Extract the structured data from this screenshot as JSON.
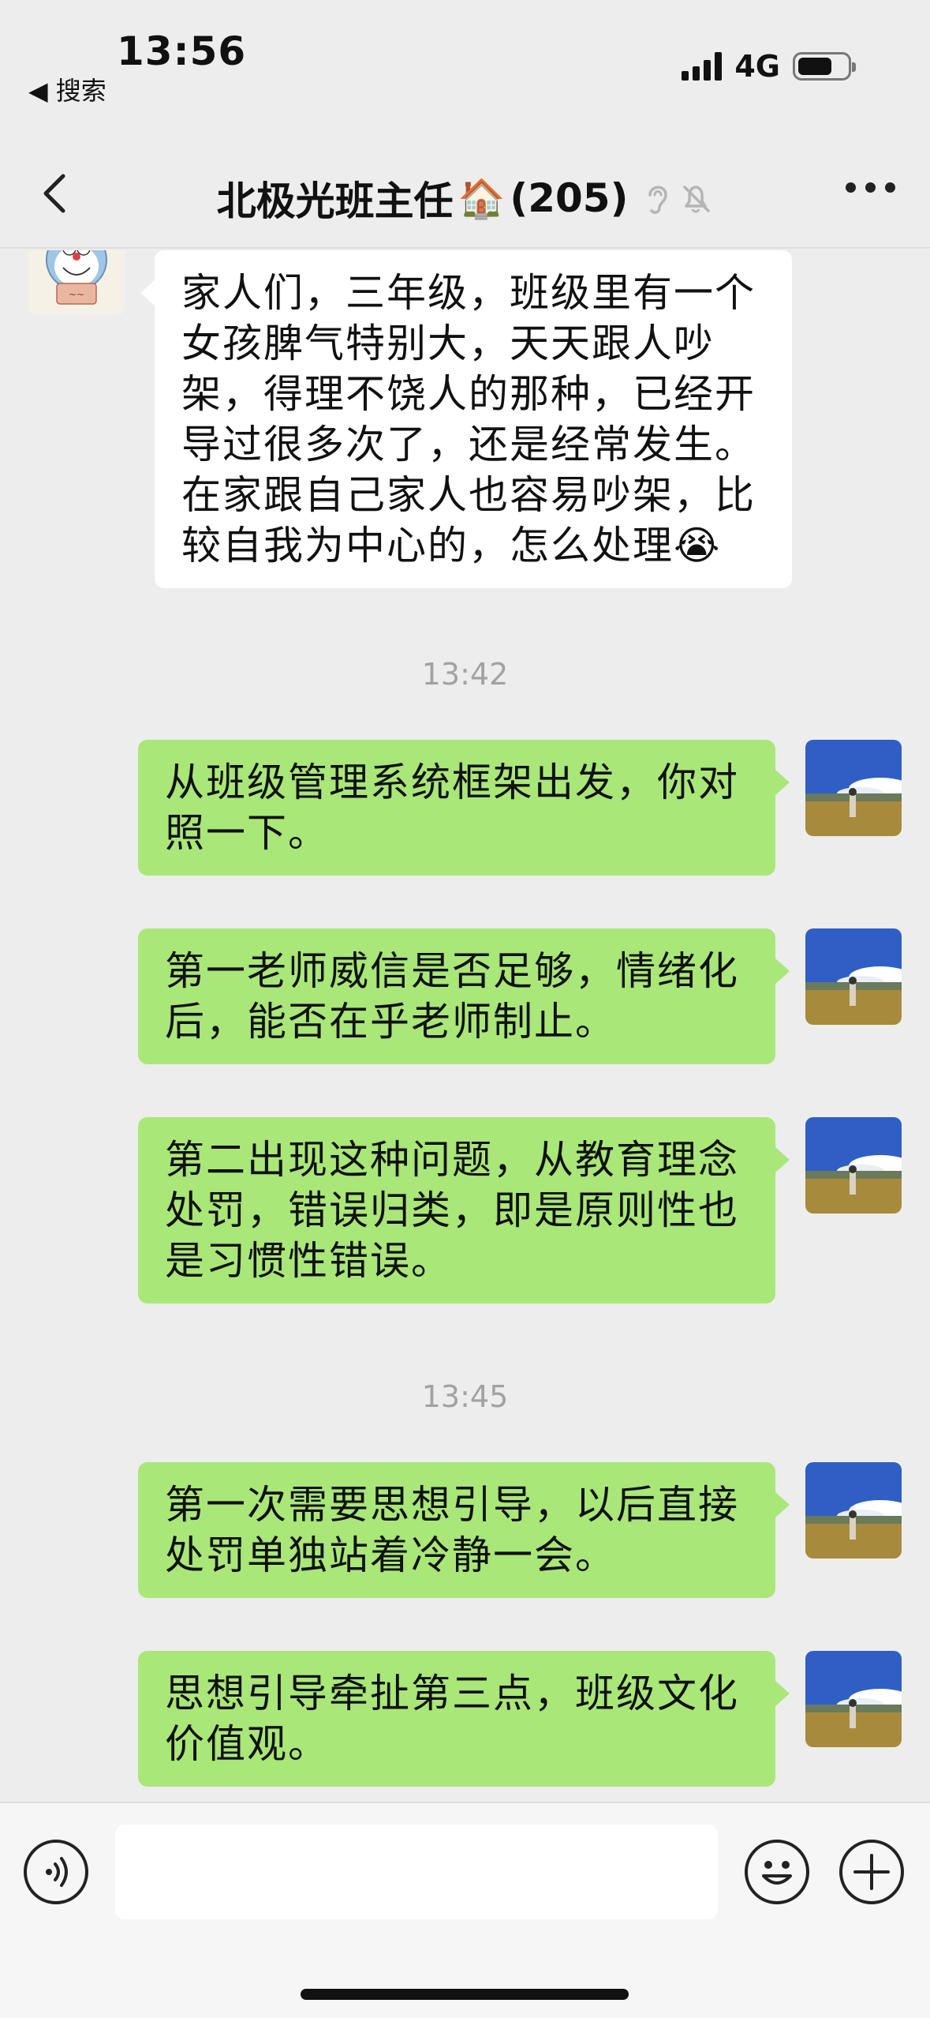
{
  "status_bar": {
    "time": "13:56",
    "back_label": "◀ 搜索",
    "network": "4G",
    "battery_level": 0.7
  },
  "nav": {
    "title": "北极光班主任",
    "title_emoji": "🏠",
    "member_count": "(205)",
    "icons": [
      "chevron-left-icon",
      "ear-icon",
      "bell-off-icon",
      "more-icon"
    ]
  },
  "messages": [
    {
      "side": "left",
      "text": "家人们，三年级，班级里有一个女孩脾气特别大，天天跟人吵架，得理不饶人的那种，已经开导过很多次了，还是经常发生。在家跟自己家人也容易吵架，比较自我为中心的，怎么处理",
      "emoji": "😭"
    },
    {
      "type": "time",
      "text": "13:42"
    },
    {
      "side": "right",
      "text": "从班级管理系统框架出发，你对照一下。"
    },
    {
      "side": "right",
      "text": "第一老师威信是否足够，情绪化后，能否在乎老师制止。"
    },
    {
      "side": "right",
      "text": "第二出现这种问题，从教育理念处罚，错误归类，即是原则性也是习惯性错误。"
    },
    {
      "type": "time",
      "text": "13:45"
    },
    {
      "side": "right",
      "text": "第一次需要思想引导，以后直接处罚单独站着冷静一会。"
    },
    {
      "side": "right",
      "text": "思想引导牵扯第三点，班级文化价值观。"
    }
  ],
  "input_bar": {
    "icons": [
      "voice-icon",
      "emoji-icon",
      "plus-icon"
    ],
    "input_value": ""
  }
}
